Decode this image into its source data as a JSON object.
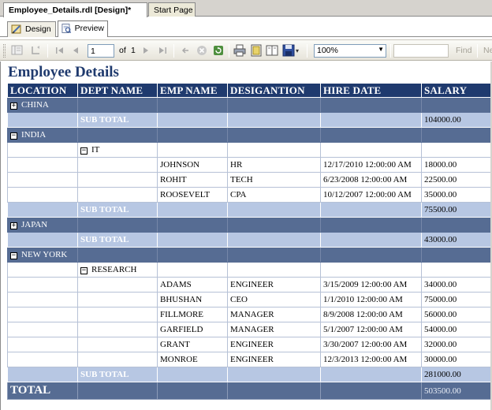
{
  "doc_tabs": [
    {
      "label": "Employee_Details.rdl [Design]*"
    },
    {
      "label": "Start Page"
    }
  ],
  "view_tabs": [
    {
      "label": "Design"
    },
    {
      "label": "Preview"
    }
  ],
  "toolbar": {
    "page_number": "1",
    "of_label": "of",
    "total_pages": "1",
    "zoom": "100%",
    "find_label": "Find",
    "next_label": "Ne"
  },
  "report": {
    "title": "Employee Details",
    "columns": [
      "LOCATION",
      "DEPT NAME",
      "EMP NAME",
      "DESIGANTION",
      "HIRE DATE",
      "SALARY"
    ],
    "subtotal_label": "SUB TOTAL",
    "toggle_expand": "+",
    "toggle_collapse": "−",
    "groups": {
      "china": {
        "location": "CHINA",
        "subtotal": "104000.00"
      },
      "india": {
        "location": "INDIA",
        "dept": "IT",
        "rows": [
          {
            "emp": "JOHNSON",
            "designation": "HR",
            "hire_date": "12/17/2010 12:00:00 AM",
            "salary": "18000.00"
          },
          {
            "emp": "ROHIT",
            "designation": "TECH",
            "hire_date": "6/23/2008 12:00:00 AM",
            "salary": "22500.00"
          },
          {
            "emp": "ROOSEVELT",
            "designation": "CPA",
            "hire_date": "10/12/2007 12:00:00 AM",
            "salary": "35000.00"
          }
        ],
        "subtotal": "75500.00"
      },
      "japan": {
        "location": "JAPAN",
        "subtotal": "43000.00"
      },
      "newyork": {
        "location": "NEW YORK",
        "dept": "RESEARCH",
        "rows": [
          {
            "emp": "ADAMS",
            "designation": "ENGINEER",
            "hire_date": "3/15/2009 12:00:00 AM",
            "salary": "34000.00"
          },
          {
            "emp": "BHUSHAN",
            "designation": "CEO",
            "hire_date": "1/1/2010 12:00:00 AM",
            "salary": "75000.00"
          },
          {
            "emp": "FILLMORE",
            "designation": "MANAGER",
            "hire_date": "8/9/2008 12:00:00 AM",
            "salary": "56000.00"
          },
          {
            "emp": "GARFIELD",
            "designation": "MANAGER",
            "hire_date": "5/1/2007 12:00:00 AM",
            "salary": "54000.00"
          },
          {
            "emp": "GRANT",
            "designation": "ENGINEER",
            "hire_date": "3/30/2007 12:00:00 AM",
            "salary": "32000.00"
          },
          {
            "emp": "MONROE",
            "designation": "ENGINEER",
            "hire_date": "12/3/2013 12:00:00 AM",
            "salary": "30000.00"
          }
        ],
        "subtotal": "281000.00"
      }
    },
    "total_label": "TOTAL",
    "total_value": "503500.00"
  },
  "colors": {
    "header_bg": "#1f3a6e",
    "group_bg": "#566c93",
    "subtotal_bg": "#b7c7e3"
  }
}
